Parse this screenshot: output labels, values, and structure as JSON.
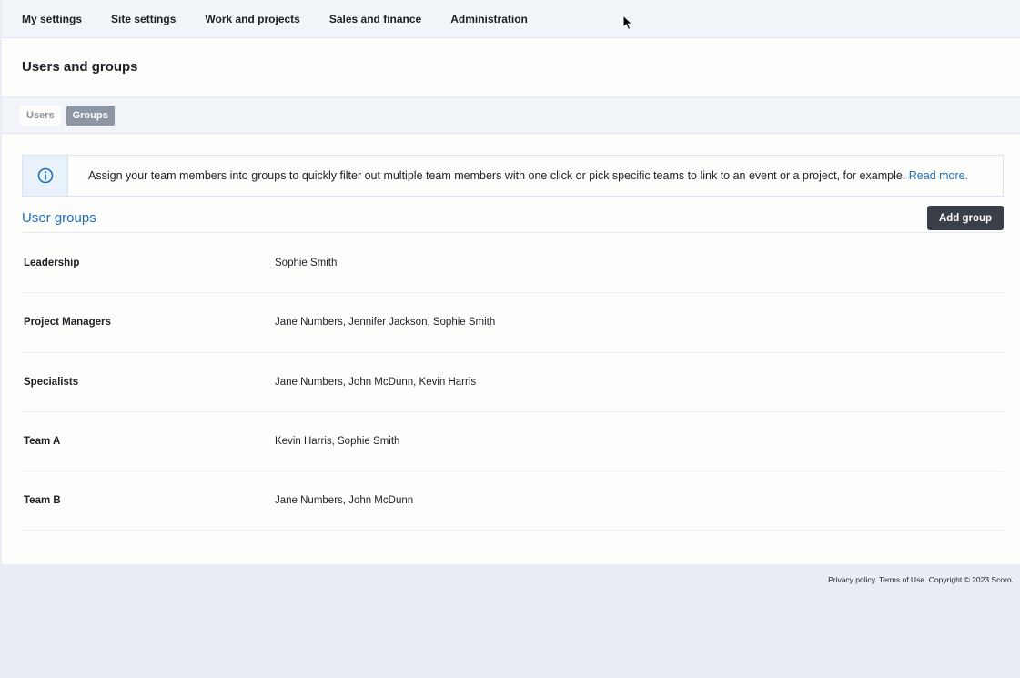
{
  "topnav": {
    "items": [
      {
        "label": "My settings"
      },
      {
        "label": "Site settings"
      },
      {
        "label": "Work and projects"
      },
      {
        "label": "Sales and finance"
      },
      {
        "label": "Administration"
      }
    ]
  },
  "page": {
    "title": "Users and groups"
  },
  "subtabs": [
    {
      "label": "Users",
      "active": false
    },
    {
      "label": "Groups",
      "active": true
    }
  ],
  "info": {
    "icon": "info-icon",
    "text": "Assign your team members into groups to quickly filter out multiple team members with one click or pick specific teams to link to an event or a project, for example.",
    "link": "Read more."
  },
  "section": {
    "title": "User groups",
    "add_button": "Add group"
  },
  "groups": [
    {
      "name": "Leadership",
      "members": "Sophie Smith"
    },
    {
      "name": "Project Managers",
      "members": "Jane Numbers, Jennifer Jackson, Sophie Smith"
    },
    {
      "name": "Specialists",
      "members": "Jane Numbers, John McDunn, Kevin Harris"
    },
    {
      "name": "Team A",
      "members": "Kevin Harris, Sophie Smith"
    },
    {
      "name": "Team B",
      "members": "Jane Numbers, John McDunn"
    }
  ],
  "footer": {
    "privacy": "Privacy policy.",
    "terms": "Terms of Use.",
    "copyright": "Copyright © 2023 Scoro."
  },
  "colors": {
    "accent": "#1e6fba",
    "button_dark": "#3a3e46",
    "nav_bg": "#f1f4f9",
    "active_tab": "#8f96a3"
  }
}
